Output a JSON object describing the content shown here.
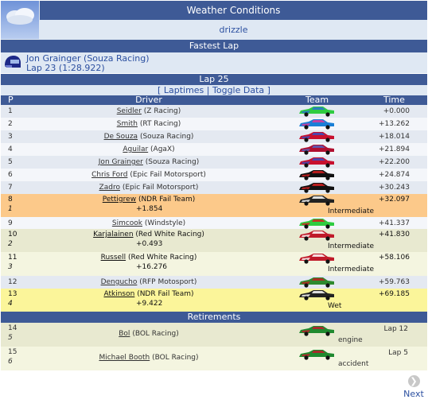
{
  "weather": {
    "title": "Weather Conditions",
    "condition": "drizzle",
    "icon": "cloud-icon"
  },
  "fastest_lap": {
    "title": "Fastest Lap",
    "driver": "Jon Grainger (Souza Racing)",
    "lap": "Lap 23 (1:28.922)",
    "icon": "helmet-icon"
  },
  "lap_section": {
    "title": "Lap 25",
    "open_bracket": "[",
    "laptimes": "Laptimes",
    "separator": "|",
    "toggle": "Toggle Data",
    "close_bracket": "]"
  },
  "columns": {
    "pos": "P",
    "driver": "Driver",
    "team": "Team",
    "time": "Time"
  },
  "results": [
    {
      "pos": "1",
      "name": "Seidler",
      "team": "(Z Racing)",
      "time": "+0.000",
      "bg": "#e4e9f1",
      "car": [
        "#2ecc40",
        "#2b6fd6"
      ]
    },
    {
      "pos": "2",
      "name": "Smith",
      "team": "(RT Racing)",
      "time": "+13.262",
      "bg": "#f4f6fa",
      "car": [
        "#1a7fd6",
        "#e0379a"
      ]
    },
    {
      "pos": "3",
      "name": "De Souza",
      "team": "(Souza Racing)",
      "time": "+18.014",
      "bg": "#e4e9f1",
      "car": [
        "#c8102e",
        "#3a4fbf"
      ]
    },
    {
      "pos": "4",
      "name": "Aguilar",
      "team": "(AgaX)",
      "time": "+21.894",
      "bg": "#f4f6fa",
      "car": [
        "#b01030",
        "#5560c0"
      ]
    },
    {
      "pos": "5",
      "name": "Jon Grainger",
      "team": "(Souza Racing)",
      "time": "+22.200",
      "bg": "#e4e9f1",
      "car": [
        "#c8102e",
        "#3a4fbf"
      ]
    },
    {
      "pos": "6",
      "name": "Chris Ford",
      "team": "(Epic Fail Motorsport)",
      "time": "+24.874",
      "bg": "#f4f6fa",
      "car": [
        "#111111",
        "#d42020"
      ]
    },
    {
      "pos": "7",
      "name": "Zadro",
      "team": "(Epic Fail Motorsport)",
      "time": "+30.243",
      "bg": "#e4e9f1",
      "car": [
        "#111111",
        "#d42020"
      ]
    }
  ],
  "feature_rows": [
    {
      "pos": "8",
      "sub": "1",
      "name": "Pettigrew",
      "team": "(NDR Fail Team)",
      "diff": "+1.854",
      "tyre": "Intermediate",
      "time": "+32.097",
      "bg": "#fcc98a",
      "car": [
        "#222222",
        "#ffffff"
      ]
    },
    {
      "pos": "10",
      "sub": "2",
      "name": "Karjalainen",
      "team": "(Red White Racing)",
      "diff": "+0.493",
      "tyre": "Intermediate",
      "time": "+41.830",
      "bg": "#e8e9d0",
      "car": [
        "#c01a2a",
        "#ffffff"
      ]
    },
    {
      "pos": "11",
      "sub": "3",
      "name": "Russell",
      "team": "(Red White Racing)",
      "diff": "+16.276",
      "tyre": "Intermediate",
      "time": "+58.106",
      "bg": "#f4f5e0",
      "car": [
        "#c01a2a",
        "#ffffff"
      ]
    },
    {
      "pos": "13",
      "sub": "4",
      "name": "Atkinson",
      "team": "(NDR Fail Team)",
      "diff": "+9.422",
      "tyre": "Wet",
      "time": "+69.185",
      "bg": "#fbf59a",
      "car": [
        "#222222",
        "#ffffff"
      ]
    }
  ],
  "single_rows": [
    {
      "pos": "9",
      "name": "Simcook",
      "team": "(Windstyle)",
      "time": "+41.337",
      "bg": "#f4f6fa",
      "car": [
        "#2ecc40",
        "#d82020"
      ]
    },
    {
      "pos": "12",
      "name": "Dengucho",
      "team": "(RFP Motosport)",
      "time": "+59.763",
      "bg": "#e4e9f1",
      "car": [
        "#2e8a2e",
        "#c02020"
      ]
    }
  ],
  "retirements": {
    "title": "Retirements",
    "rows": [
      {
        "pos": "14",
        "sub": "5",
        "name": "Bol",
        "team": "(BOL Racing)",
        "lap": "Lap 12",
        "reason": "engine",
        "bg": "#e8e9d0",
        "car": [
          "#1f8a2f",
          "#c01a2a"
        ]
      },
      {
        "pos": "15",
        "sub": "6",
        "name": "Michael Booth",
        "team": "(BOL Racing)",
        "lap": "Lap 5",
        "reason": "accident",
        "bg": "#f4f5e0",
        "car": [
          "#1f8a2f",
          "#c01a2a"
        ]
      }
    ]
  },
  "next": {
    "label": "Next",
    "icon": "chevron-right-icon"
  }
}
